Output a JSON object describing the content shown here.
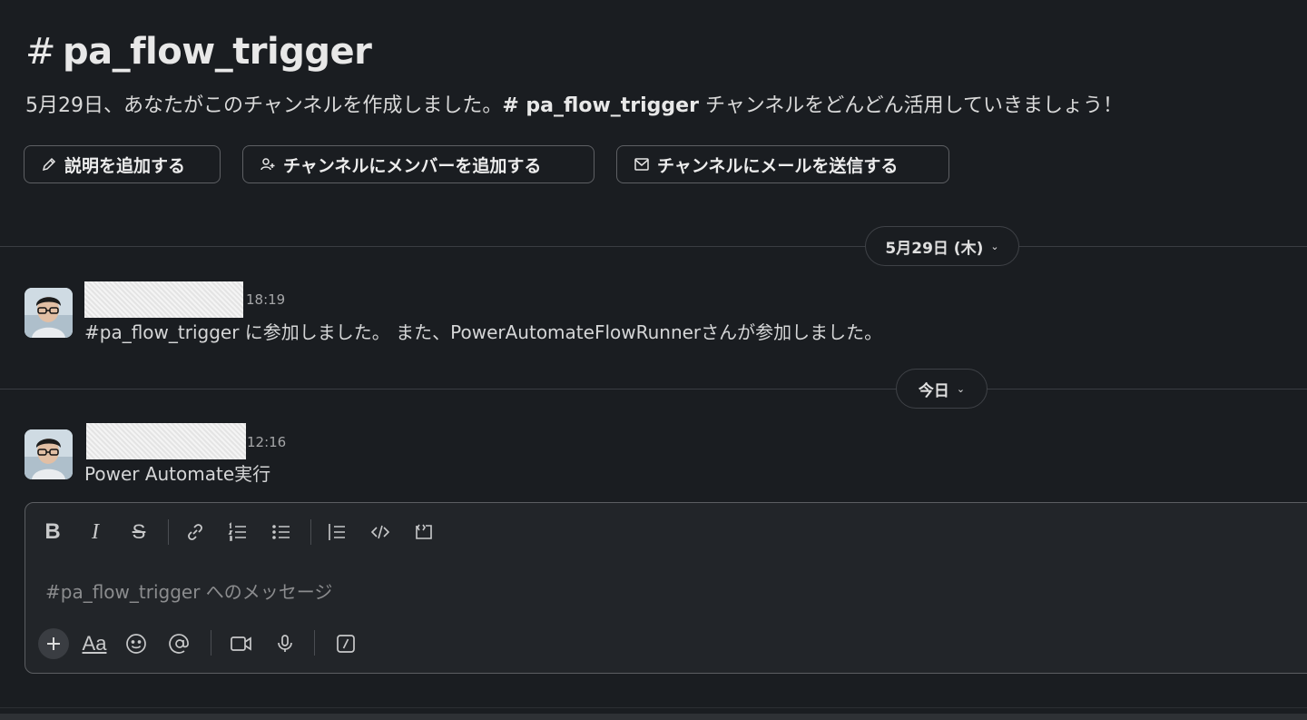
{
  "channel": {
    "hash": "#",
    "name": "pa_flow_trigger",
    "description_prefix": "5月29日、あなたがこのチャンネルを作成しました。",
    "description_channel": "# pa_flow_trigger",
    "description_suffix": " チャンネルをどんどん活用していきましょう！"
  },
  "actions": {
    "add_description": "説明を追加する",
    "add_members": "チャンネルにメンバーを追加する",
    "send_email": "チャンネルにメールを送信する"
  },
  "dividers": {
    "first_date": "5月29日 (木)",
    "today": "今日"
  },
  "messages": [
    {
      "time": "18:19",
      "text": "#pa_flow_trigger に参加しました。 また、PowerAutomateFlowRunnerさんが参加しました。"
    },
    {
      "time": "12:16",
      "text": "Power Automate実行"
    }
  ],
  "composer": {
    "placeholder": "#pa_flow_trigger へのメッセージ"
  },
  "colors": {
    "background": "#1a1d21",
    "composer_bg": "#222529",
    "border": "#5c5e62"
  }
}
